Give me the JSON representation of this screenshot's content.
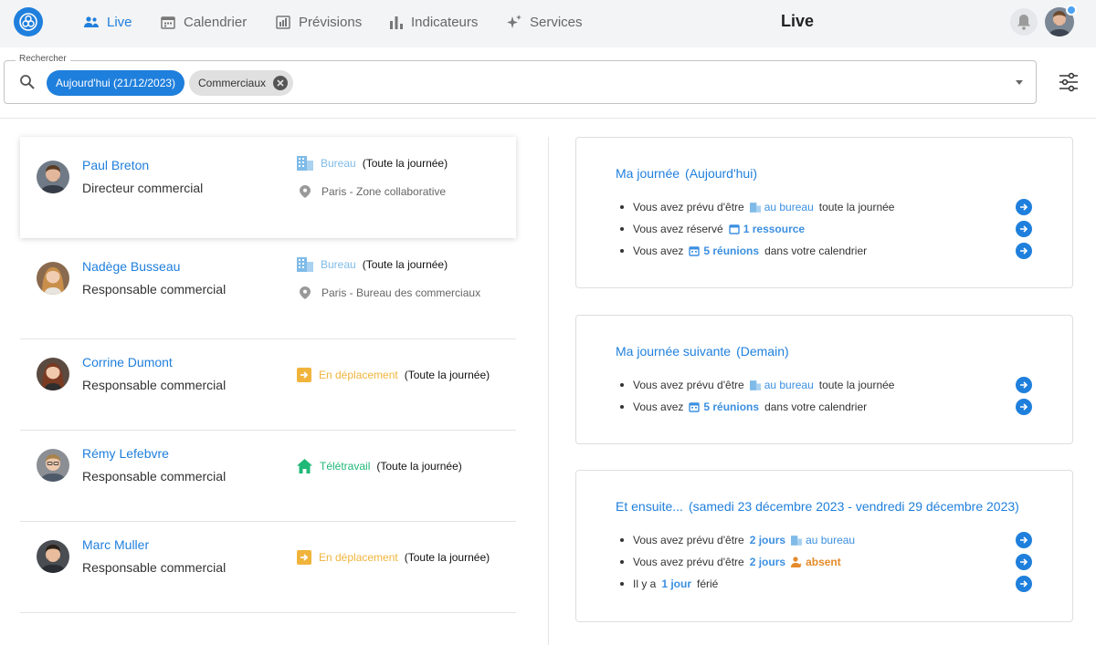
{
  "header": {
    "nav": [
      {
        "label": "Live",
        "icon": "people-icon",
        "active": true
      },
      {
        "label": "Calendrier",
        "icon": "calendar-icon"
      },
      {
        "label": "Prévisions",
        "icon": "forecast-icon"
      },
      {
        "label": "Indicateurs",
        "icon": "bar-chart-icon"
      },
      {
        "label": "Services",
        "icon": "sparkle-icon"
      }
    ],
    "title": "Live"
  },
  "search": {
    "legend": "Rechercher",
    "chips": [
      "Aujourd'hui (21/12/2023)",
      "Commerciaux"
    ]
  },
  "people": [
    {
      "name": "Paul Breton",
      "role": "Directeur commercial",
      "status": "Bureau",
      "duration": "(Toute la journée)",
      "location": "Paris - Zone collaborative"
    },
    {
      "name": "Nadège Busseau",
      "role": "Responsable commercial",
      "status": "Bureau",
      "duration": "(Toute la journée)",
      "location": "Paris - Bureau des commerciaux"
    },
    {
      "name": "Corrine Dumont",
      "role": "Responsable commercial",
      "status": "En déplacement",
      "duration": "(Toute la journée)"
    },
    {
      "name": "Rémy Lefebvre",
      "role": "Responsable commercial",
      "status": "Télétravail",
      "duration": "(Toute la journée)"
    },
    {
      "name": "Marc Muller",
      "role": "Responsable commercial",
      "status": "En déplacement",
      "duration": "(Toute la journée)"
    }
  ],
  "status_colors": {
    "office": "#7fbbe8",
    "travel": "#f0b43c",
    "remote": "#1fb877",
    "absent": "#e48a2a",
    "accent": "#1f7fdc"
  },
  "cards": {
    "today": {
      "title": "Ma journée",
      "subtitle": "(Aujourd'hui)",
      "l1": {
        "pre": "Vous avez prévu d'être",
        "hl": "au bureau",
        "post": "toute la journée"
      },
      "l2": {
        "pre": "Vous avez réservé",
        "hl": "1 ressource"
      },
      "l3": {
        "pre": "Vous avez",
        "hl": "5 réunions",
        "post": "dans votre calendrier"
      }
    },
    "tomorrow": {
      "title": "Ma journée suivante",
      "subtitle": "(Demain)",
      "l1": {
        "pre": "Vous avez prévu d'être",
        "hl": "au bureau",
        "post": "toute la journée"
      },
      "l2": {
        "pre": "Vous avez",
        "hl": "5 réunions",
        "post": "dans votre calendrier"
      }
    },
    "after": {
      "title": "Et ensuite...",
      "subtitle": "(samedi 23 décembre 2023 - vendredi 29 décembre 2023)",
      "l1": {
        "pre": "Vous avez prévu d'être",
        "n": "2 jours",
        "hl": "au bureau"
      },
      "l2": {
        "pre": "Vous avez prévu d'être",
        "n": "2 jours",
        "hl": "absent"
      },
      "l3": {
        "pre": "Il y a",
        "n": "1 jour",
        "post": "férié"
      }
    }
  }
}
